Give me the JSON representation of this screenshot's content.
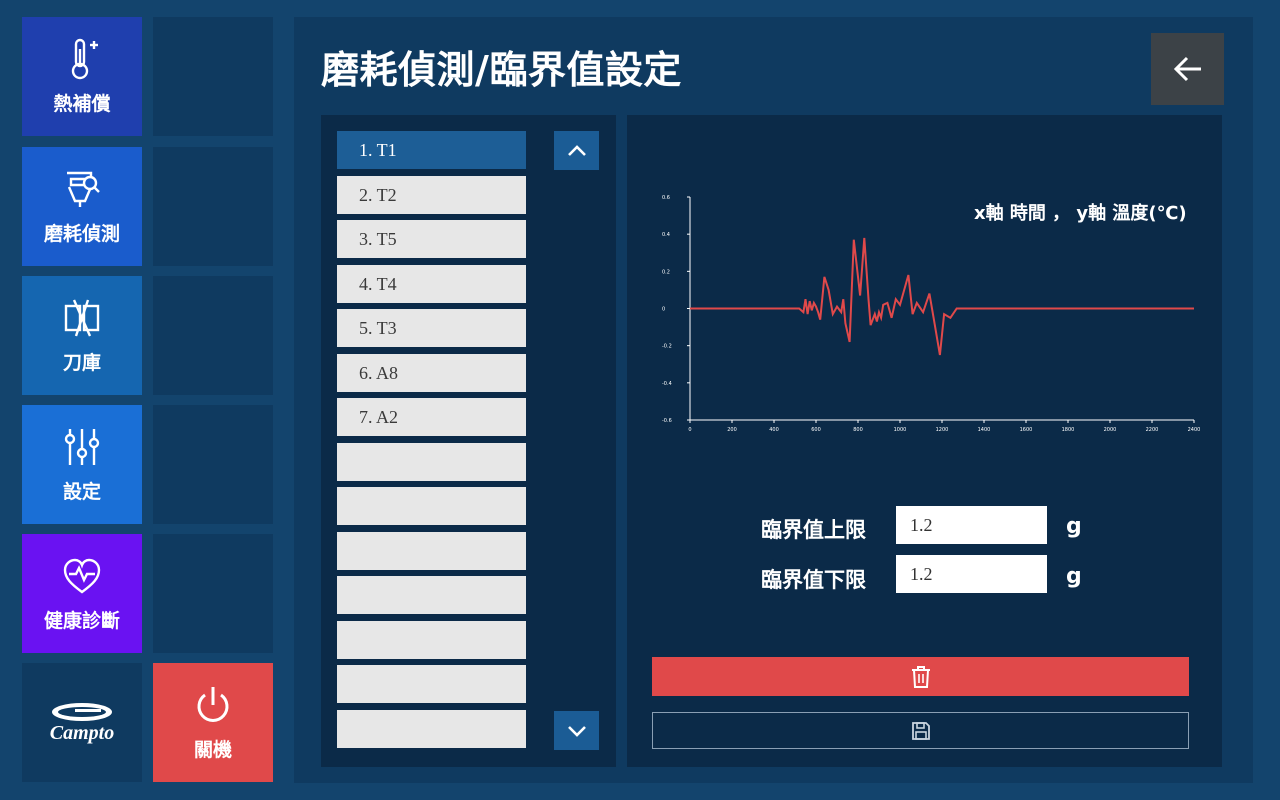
{
  "sidebar": {
    "items": [
      {
        "label": "熱補償",
        "icon": "thermometer-plus-icon",
        "color": "#1f3fae"
      },
      {
        "label": "磨耗偵測",
        "icon": "wear-detect-icon",
        "color": "#1a5ccc"
      },
      {
        "label": "刀庫",
        "icon": "tool-magazine-icon",
        "color": "#1566b0"
      },
      {
        "label": "設定",
        "icon": "sliders-icon",
        "color": "#1a6fd6"
      },
      {
        "label": "健康診斷",
        "icon": "heart-pulse-icon",
        "color": "#6a12f2"
      }
    ],
    "logo_text": "Campto",
    "power_label": "關機",
    "power_color": "#e0494a"
  },
  "header": {
    "title": "磨耗偵測/臨界值設定",
    "back_icon": "arrow-left-icon"
  },
  "tool_list": {
    "items": [
      "1. T1",
      "2. T2",
      "3. T5",
      "4. T4",
      "5. T3",
      "6. A8",
      "7. A2",
      "",
      "",
      "",
      "",
      "",
      "",
      ""
    ],
    "selected_index": 0
  },
  "chart_data": {
    "type": "line",
    "title": "x軸 時間 ， y軸 溫度(℃)",
    "xlabel": "",
    "ylabel": "",
    "xlim": [
      0,
      2400
    ],
    "ylim": [
      -0.6,
      0.6
    ],
    "x_ticks": [
      "0",
      "200",
      "400",
      "600",
      "800",
      "1000",
      "1200",
      "1400",
      "1600",
      "1800",
      "2000",
      "2200",
      "2400"
    ],
    "y_ticks": [
      "0.6",
      "0.4",
      "0.2",
      "0",
      "-0.2",
      "-0.4",
      "-0.6"
    ],
    "line_color": "#e0494a",
    "grid": false,
    "x": [
      0,
      520,
      540,
      550,
      560,
      570,
      580,
      590,
      600,
      610,
      620,
      640,
      660,
      680,
      700,
      720,
      730,
      740,
      760,
      780,
      810,
      830,
      850,
      860,
      870,
      880,
      890,
      900,
      910,
      920,
      940,
      960,
      980,
      1000,
      1040,
      1060,
      1080,
      1110,
      1140,
      1160,
      1190,
      1210,
      1240,
      1270,
      2400
    ],
    "y": [
      0,
      0,
      -0.02,
      0.05,
      -0.03,
      0.04,
      -0.01,
      0.03,
      0.01,
      -0.02,
      -0.06,
      0.17,
      0.1,
      -0.03,
      0.01,
      -0.02,
      0.05,
      -0.08,
      -0.18,
      0.37,
      0.07,
      0.38,
      0.05,
      -0.09,
      -0.06,
      -0.03,
      -0.07,
      -0.02,
      -0.05,
      0.02,
      0.03,
      -0.05,
      0.05,
      0.02,
      0.18,
      -0.03,
      0.03,
      -0.02,
      0.08,
      -0.05,
      -0.25,
      -0.03,
      -0.05,
      0,
      0
    ]
  },
  "threshold": {
    "upper_label": "臨界值上限",
    "upper_value": "1.2",
    "lower_label": "臨界值下限",
    "lower_value": "1.2",
    "unit": "g"
  },
  "actions": {
    "delete_icon": "trash-icon",
    "save_icon": "save-icon"
  }
}
